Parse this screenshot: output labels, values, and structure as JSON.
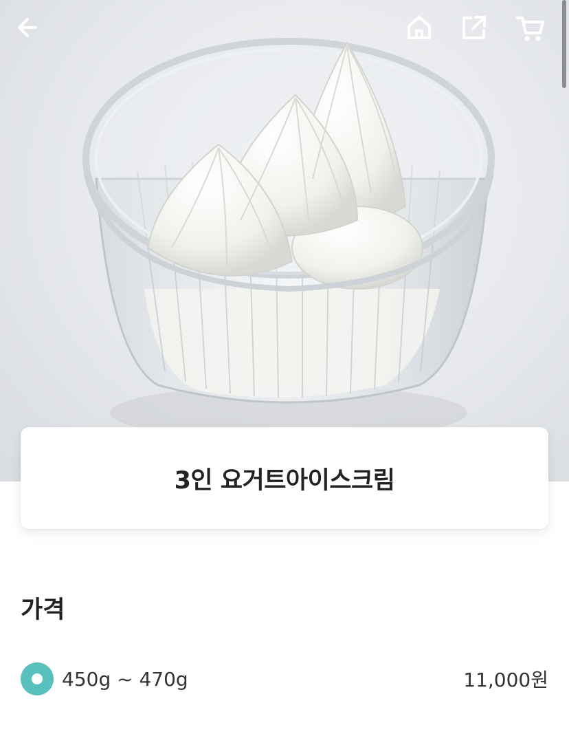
{
  "header": {
    "icons": [
      "arrow-left-icon",
      "home-icon",
      "share-icon",
      "cart-icon"
    ]
  },
  "product": {
    "name": "3인 요거트아이스크림",
    "image_subject": "yogurt-ice-cream-in-clear-cup"
  },
  "price_section": {
    "title": "가격",
    "options": [
      {
        "label": "450g ~ 470g",
        "price": "11,000원",
        "selected": true
      }
    ]
  },
  "colors": {
    "accent": "#58c1bd",
    "text": "#222222",
    "icon": "#ffffff"
  }
}
